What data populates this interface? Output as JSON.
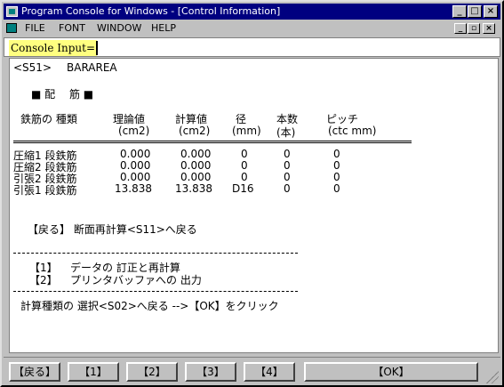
{
  "window": {
    "title": "Program Console for Windows - [Control Information]",
    "minimize": "_",
    "maximize": "□",
    "close": "×"
  },
  "menu": {
    "items": [
      "FILE",
      "FONT",
      "WINDOW",
      "HELP"
    ],
    "mdi_minimize": "_",
    "mdi_restore": "▫",
    "mdi_close": "×"
  },
  "console": {
    "label": "Console Input=",
    "value": ""
  },
  "content": {
    "screen_id": "<S51>",
    "screen_name": "BARAREA",
    "section_title": "■ 配　 筋 ■",
    "headers": {
      "type": "鉄筋の 種類",
      "theory": "理論値",
      "theory_unit": "(cm2)",
      "calc": "計算値",
      "calc_unit": "(cm2)",
      "diameter": "径",
      "diameter_unit": "(mm)",
      "count": "本数",
      "count_unit": "(本)",
      "pitch": "ピッチ",
      "pitch_unit": "(ctc mm)"
    },
    "rows": [
      {
        "type": "圧縮1 段鉄筋",
        "theory": "0.000",
        "calc": "0.000",
        "diameter": "0",
        "count": "0",
        "pitch": "0"
      },
      {
        "type": "圧縮2 段鉄筋",
        "theory": "0.000",
        "calc": "0.000",
        "diameter": "0",
        "count": "0",
        "pitch": "0"
      },
      {
        "type": "引張2 段鉄筋",
        "theory": "0.000",
        "calc": "0.000",
        "diameter": "0",
        "count": "0",
        "pitch": "0"
      },
      {
        "type": "引張1 段鉄筋",
        "theory": "13.838",
        "calc": "13.838",
        "diameter": "D16",
        "count": "0",
        "pitch": "0"
      }
    ],
    "back_link": "【戻る】 断面再計算<S11>へ戻る",
    "options": [
      {
        "key": "【1】",
        "label": "データの 訂正と再計算"
      },
      {
        "key": "【2】",
        "label": "プリンタバッファへの 出力"
      }
    ],
    "footer_note": "計算種類の 選択<S02>へ戻る -->【OK】をクリック"
  },
  "function_buttons": [
    "【戻る】",
    "【1】",
    "【2】",
    "【3】",
    "【4】",
    "【OK】"
  ]
}
